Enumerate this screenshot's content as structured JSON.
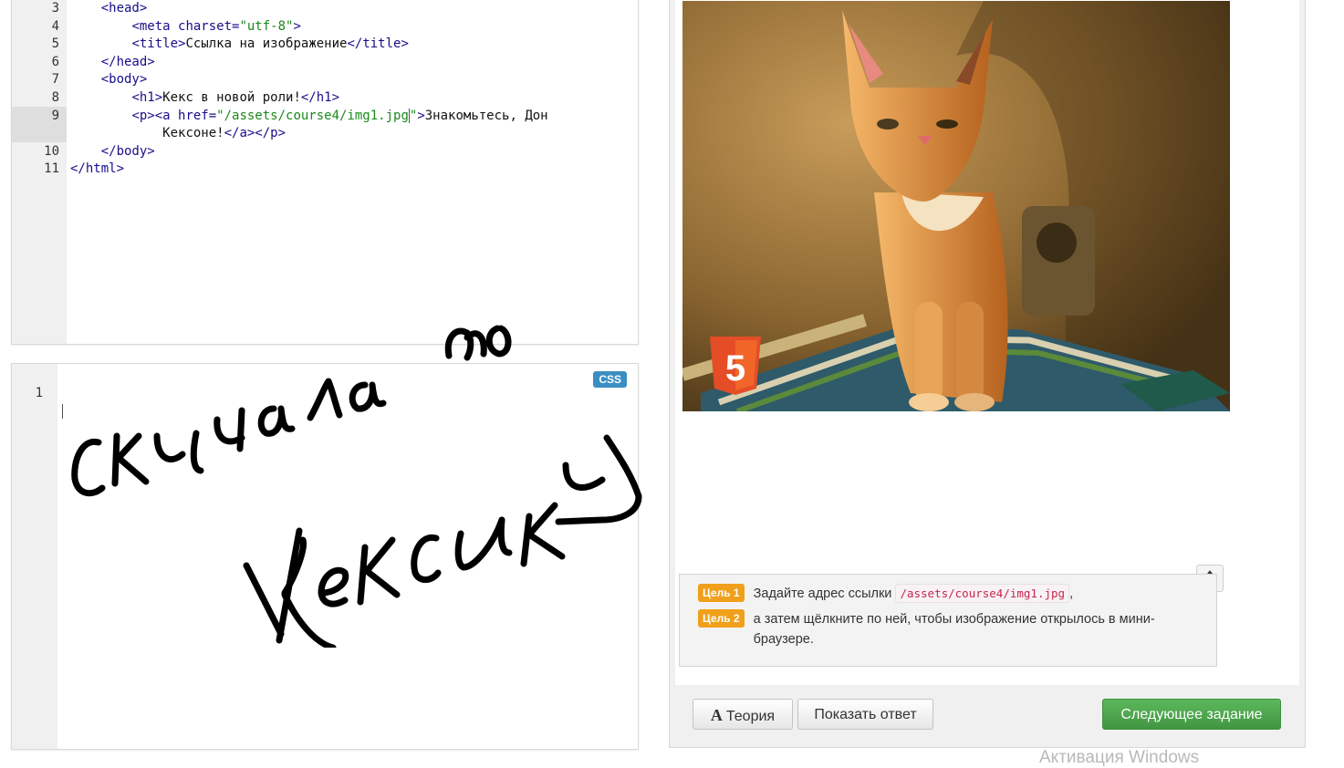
{
  "html_editor": {
    "lines": [
      {
        "num": "3",
        "indent": "    ",
        "parts": [
          {
            "t": "tag",
            "v": "<head>"
          }
        ]
      },
      {
        "num": "4",
        "indent": "        ",
        "parts": [
          {
            "t": "tag",
            "v": "<meta charset="
          },
          {
            "t": "str",
            "v": "\"utf-8\""
          },
          {
            "t": "tag",
            "v": ">"
          }
        ]
      },
      {
        "num": "5",
        "indent": "        ",
        "parts": [
          {
            "t": "tag",
            "v": "<title>"
          },
          {
            "t": "txt",
            "v": "Ссылка на изображение"
          },
          {
            "t": "tag",
            "v": "</title>"
          }
        ]
      },
      {
        "num": "6",
        "indent": "    ",
        "parts": [
          {
            "t": "tag",
            "v": "</head>"
          }
        ]
      },
      {
        "num": "7",
        "indent": "    ",
        "parts": [
          {
            "t": "tag",
            "v": "<body>"
          }
        ]
      },
      {
        "num": "8",
        "indent": "        ",
        "parts": [
          {
            "t": "tag",
            "v": "<h1>"
          },
          {
            "t": "txt",
            "v": "Кекс в новой роли!"
          },
          {
            "t": "tag",
            "v": "</h1>"
          }
        ]
      },
      {
        "num": "9",
        "indent": "        ",
        "parts": [
          {
            "t": "tag",
            "v": "<p><a href="
          },
          {
            "t": "str",
            "v": "\"/assets/course4/img1.jpg"
          },
          {
            "t": "cursor",
            "v": ""
          },
          {
            "t": "str",
            "v": "\""
          },
          {
            "t": "tag",
            "v": ">"
          },
          {
            "t": "txt",
            "v": "Знакомьтесь, Дон"
          }
        ]
      },
      {
        "num": "",
        "indent": "            ",
        "parts": [
          {
            "t": "txt",
            "v": "Кексоне!"
          },
          {
            "t": "tag",
            "v": "</a></p>"
          }
        ]
      },
      {
        "num": "10",
        "indent": "    ",
        "parts": [
          {
            "t": "tag",
            "v": "</body>"
          }
        ]
      },
      {
        "num": "11",
        "indent": "",
        "parts": [
          {
            "t": "tag",
            "v": "</html>"
          }
        ]
      }
    ]
  },
  "css_editor": {
    "line_number": "1",
    "badge": "CSS"
  },
  "goals": [
    {
      "badge": "Цель 1",
      "text_before": "Задайте адрес ссылки",
      "code": "/assets/course4/img1.jpg",
      "text_after": ","
    },
    {
      "badge": "Цель 2",
      "text": "а затем щёлкните по ней, чтобы изображение открылось в мини-браузере."
    }
  ],
  "buttons": {
    "theory_icon": "A",
    "theory": "Теория",
    "show_answer": "Показать ответ",
    "next_task": "Следующее задание",
    "scroll_up_icon": "🡅"
  },
  "image": {
    "badge_text": "5"
  },
  "watermark": "Активация Windows"
}
